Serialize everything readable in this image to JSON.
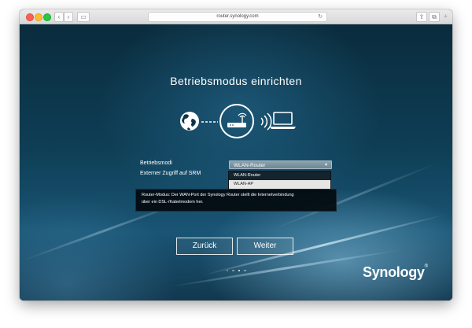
{
  "browser": {
    "url": "router.synology.com",
    "back_glyph": "‹",
    "forward_glyph": "›",
    "sidebar_glyph": "▭",
    "reload_glyph": "↻",
    "share_glyph": "⇪",
    "tabs_glyph": "⧉",
    "newtab_glyph": "+"
  },
  "wizard": {
    "title": "Betriebsmodus einrichten",
    "mode_label": "Betriebsmodi",
    "srm_label": "Externer Zugriff auf SRM",
    "selected_mode": "WLAN-Router",
    "caret": "▾",
    "options": [
      "WLAN-Router",
      "WLAN-AP"
    ],
    "highlighted_option_index": 1,
    "info_line1": "Router-Modus: Der WAN-Port der Synology Router stellt die Internetverbindung",
    "info_line2": "über ein DSL-/Kabelmodem her.",
    "back_button": "Zurück",
    "next_button": "Weiter",
    "steps_total": 4,
    "step_active_index": 2
  },
  "branding": {
    "logo_text": "Synology",
    "logo_mark": "®"
  },
  "colors": {
    "background_dark": "#0d3346",
    "accent_light": "#8cc8e6",
    "select_bg": "#7d95a2",
    "dropdown_bg": "#15232c",
    "highlight_bg": "#e6e6e6"
  },
  "icons": [
    "globe-icon",
    "router-icon",
    "wifi-signal-icon",
    "laptop-icon"
  ]
}
